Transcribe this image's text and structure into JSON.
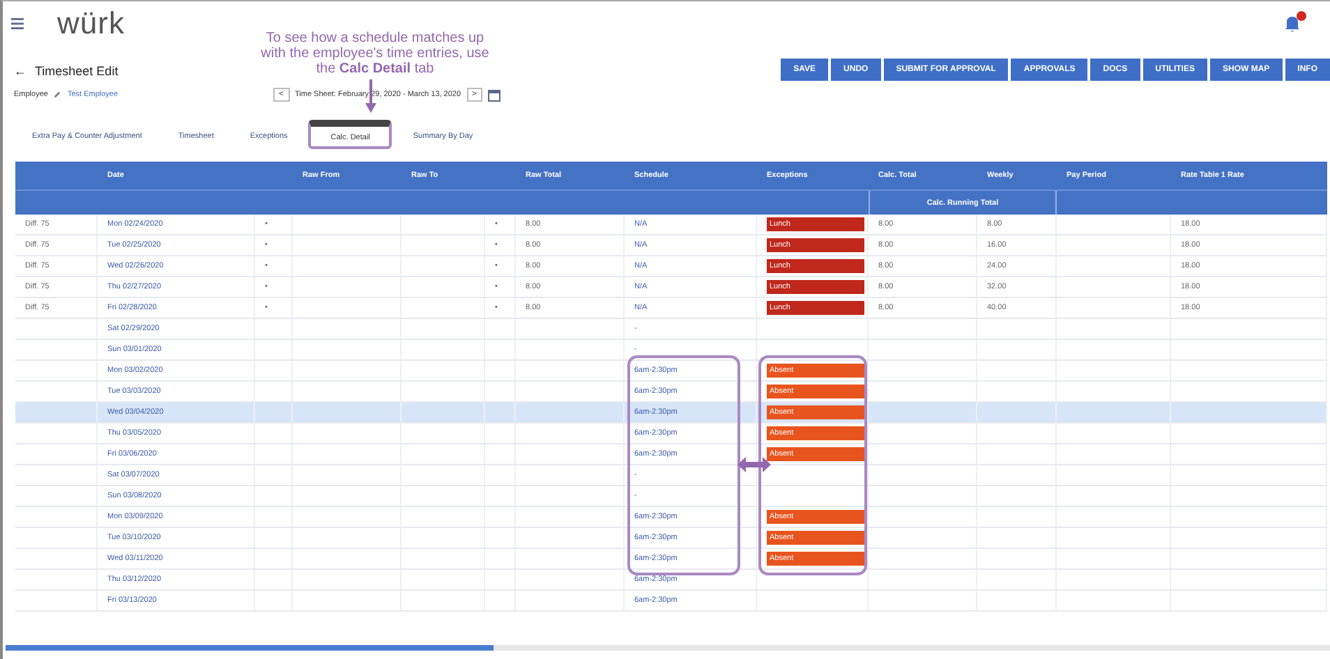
{
  "header": {
    "logo": "würk",
    "notifications": {
      "badge": true
    }
  },
  "annotation": {
    "text": "To see how a schedule matches up with the employee's time entries, use the **Calc Detail** tab"
  },
  "toolbar": {
    "buttons": [
      "SAVE",
      "UNDO",
      "SUBMIT FOR APPROVAL",
      "APPROVALS",
      "DOCS",
      "UTILITIES",
      "SHOW MAP",
      "INFO"
    ]
  },
  "page": {
    "back": "←",
    "title": "Timesheet Edit",
    "employee_label": "Employee",
    "employee_name": "Test Employee"
  },
  "period": {
    "prev": "<",
    "label": "Time Sheet: February 29, 2020 - March 13, 2020",
    "next": ">"
  },
  "tabs": [
    {
      "label": "Extra Pay & Counter Adjustment",
      "selected": false
    },
    {
      "label": "Timesheet",
      "selected": false
    },
    {
      "label": "Exceptions",
      "selected": false
    },
    {
      "label": "Calc. Detail",
      "selected": true
    },
    {
      "label": "Summary By Day",
      "selected": false
    }
  ],
  "table": {
    "columns": [
      "",
      "Date",
      "",
      "Raw From",
      "Raw To",
      "",
      "Raw Total",
      "Schedule",
      "Exceptions",
      "Calc. Total",
      "Weekly",
      "Pay Period",
      "Rate Table 1 Rate"
    ],
    "group_header": "Calc. Running Total",
    "rows": [
      {
        "selected": false,
        "cells": [
          "Diff. 75",
          "Mon 02/24/2020",
          "•",
          "",
          "",
          "•",
          "8.00",
          "N/A",
          "",
          "8.00",
          "8.00",
          "",
          "18.00"
        ],
        "exception": {
          "kind": "lunch",
          "label": "Lunch"
        }
      },
      {
        "selected": false,
        "cells": [
          "Diff. 75",
          "Tue 02/25/2020",
          "•",
          "",
          "",
          "•",
          "8.00",
          "N/A",
          "",
          "8.00",
          "16.00",
          "",
          "18.00"
        ],
        "exception": {
          "kind": "lunch",
          "label": "Lunch"
        }
      },
      {
        "selected": false,
        "cells": [
          "Diff. 75",
          "Wed 02/26/2020",
          "•",
          "",
          "",
          "•",
          "8.00",
          "N/A",
          "",
          "8.00",
          "24.00",
          "",
          "18.00"
        ],
        "exception": {
          "kind": "lunch",
          "label": "Lunch"
        }
      },
      {
        "selected": false,
        "cells": [
          "Diff. 75",
          "Thu 02/27/2020",
          "•",
          "",
          "",
          "•",
          "8.00",
          "N/A",
          "",
          "8.00",
          "32.00",
          "",
          "18.00"
        ],
        "exception": {
          "kind": "lunch",
          "label": "Lunch"
        }
      },
      {
        "selected": false,
        "cells": [
          "Diff. 75",
          "Fri 02/28/2020",
          "•",
          "",
          "",
          "•",
          "8.00",
          "N/A",
          "",
          "8.00",
          "40.00",
          "",
          "18.00"
        ],
        "exception": {
          "kind": "lunch",
          "label": "Lunch"
        }
      },
      {
        "selected": false,
        "cells": [
          "",
          "Sat 02/29/2020",
          "",
          "",
          "",
          "",
          "",
          "-",
          "",
          "",
          "",
          "",
          ""
        ]
      },
      {
        "selected": false,
        "cells": [
          "",
          "Sun 03/01/2020",
          "",
          "",
          "",
          "",
          "",
          "-",
          "",
          "",
          "",
          "",
          ""
        ]
      },
      {
        "selected": false,
        "cells": [
          "",
          "Mon 03/02/2020",
          "",
          "",
          "",
          "",
          "",
          "6am-2:30pm",
          "",
          "",
          "",
          "",
          ""
        ],
        "exception": {
          "kind": "absent",
          "label": "Absent"
        }
      },
      {
        "selected": false,
        "cells": [
          "",
          "Tue 03/03/2020",
          "",
          "",
          "",
          "",
          "",
          "6am-2:30pm",
          "",
          "",
          "",
          "",
          ""
        ],
        "exception": {
          "kind": "absent",
          "label": "Absent"
        }
      },
      {
        "selected": true,
        "cells": [
          "",
          "Wed 03/04/2020",
          "",
          "",
          "",
          "",
          "",
          "6am-2:30pm",
          "",
          "",
          "",
          "",
          ""
        ],
        "exception": {
          "kind": "absent",
          "label": "Absent"
        }
      },
      {
        "selected": false,
        "cells": [
          "",
          "Thu 03/05/2020",
          "",
          "",
          "",
          "",
          "",
          "6am-2:30pm",
          "",
          "",
          "",
          "",
          ""
        ],
        "exception": {
          "kind": "absent",
          "label": "Absent"
        }
      },
      {
        "selected": false,
        "cells": [
          "",
          "Fri 03/06/2020",
          "",
          "",
          "",
          "",
          "",
          "6am-2:30pm",
          "",
          "",
          "",
          "",
          ""
        ],
        "exception": {
          "kind": "absent",
          "label": "Absent"
        }
      },
      {
        "selected": false,
        "cells": [
          "",
          "Sat 03/07/2020",
          "",
          "",
          "",
          "",
          "",
          "-",
          "",
          "",
          "",
          "",
          ""
        ]
      },
      {
        "selected": false,
        "cells": [
          "",
          "Sun 03/08/2020",
          "",
          "",
          "",
          "",
          "",
          "-",
          "",
          "",
          "",
          "",
          ""
        ]
      },
      {
        "selected": false,
        "cells": [
          "",
          "Mon 03/09/2020",
          "",
          "",
          "",
          "",
          "",
          "6am-2:30pm",
          "",
          "",
          "",
          "",
          ""
        ],
        "exception": {
          "kind": "absent",
          "label": "Absent"
        }
      },
      {
        "selected": false,
        "cells": [
          "",
          "Tue 03/10/2020",
          "",
          "",
          "",
          "",
          "",
          "6am-2:30pm",
          "",
          "",
          "",
          "",
          ""
        ],
        "exception": {
          "kind": "absent",
          "label": "Absent"
        }
      },
      {
        "selected": false,
        "cells": [
          "",
          "Wed 03/11/2020",
          "",
          "",
          "",
          "",
          "",
          "6am-2:30pm",
          "",
          "",
          "",
          "",
          ""
        ],
        "exception": {
          "kind": "absent",
          "label": "Absent"
        }
      },
      {
        "selected": false,
        "cells": [
          "",
          "Thu 03/12/2020",
          "",
          "",
          "",
          "",
          "",
          "6am-2:30pm",
          "",
          "",
          "",
          "",
          ""
        ]
      },
      {
        "selected": false,
        "cells": [
          "",
          "Fri 03/13/2020",
          "",
          "",
          "",
          "",
          "",
          "6am-2:30pm",
          "",
          "",
          "",
          "",
          ""
        ]
      }
    ]
  }
}
